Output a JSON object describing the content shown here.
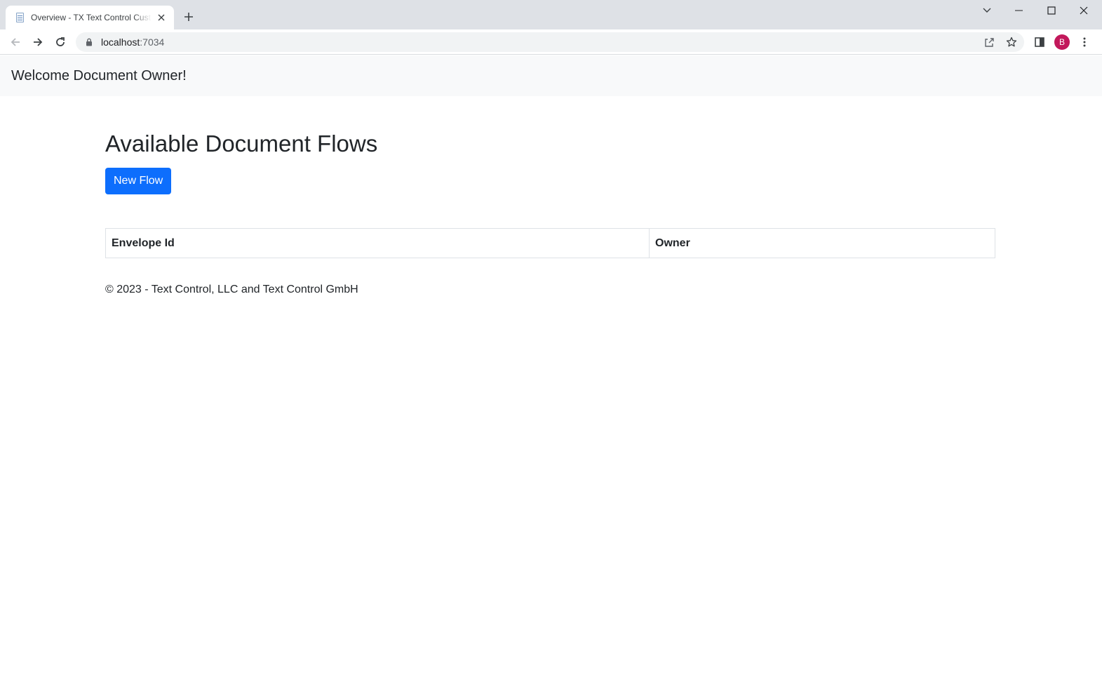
{
  "browser": {
    "tab": {
      "title": "Overview - TX Text Control Customer Portal"
    },
    "address": {
      "host": "localhost",
      "port": ":7034"
    },
    "profile": {
      "initial": "B",
      "color": "#c2185b"
    }
  },
  "navbar": {
    "brand": "Welcome Document Owner!"
  },
  "main": {
    "title": "Available Document Flows",
    "new_flow_label": "New Flow",
    "table": {
      "headers": [
        "Envelope Id",
        "Owner"
      ]
    }
  },
  "footer": {
    "text": "© 2023 - Text Control, LLC and Text Control GmbH"
  },
  "colors": {
    "primary": "#0d6efd",
    "navbar_bg": "#f8f9fa"
  }
}
